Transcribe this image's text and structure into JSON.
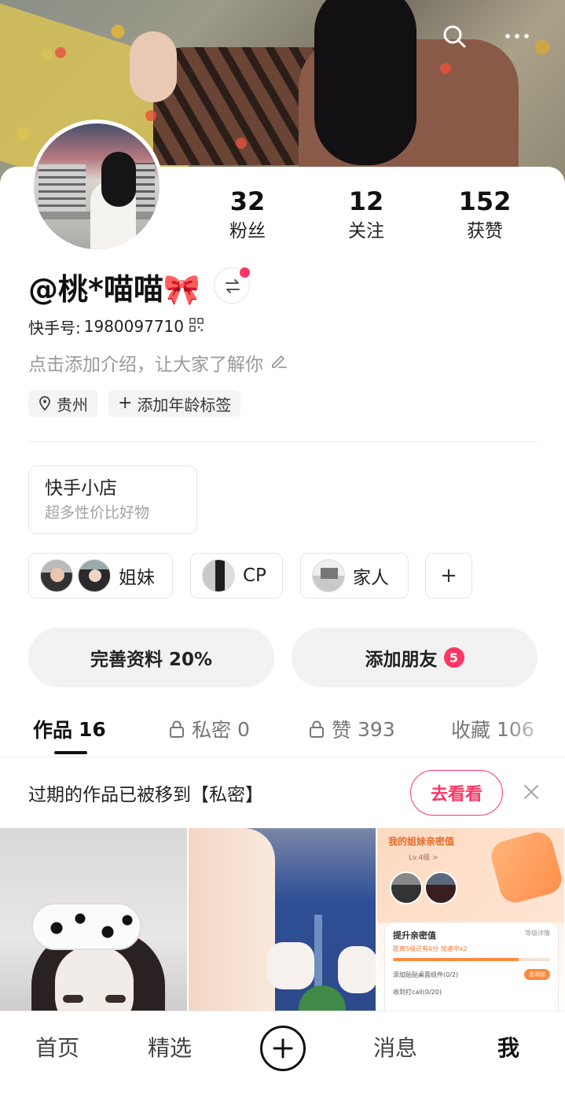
{
  "stats": [
    {
      "num": "32",
      "label": "粉丝"
    },
    {
      "num": "12",
      "label": "关注"
    },
    {
      "num": "152",
      "label": "获赞"
    }
  ],
  "profile": {
    "name": "@桃*喵喵🎀",
    "kuaishou_id_label": "快手号:",
    "kuaishou_id": "1980097710",
    "intro_placeholder": "点击添加介绍，让大家了解你",
    "location": "贵州",
    "add_age_tag": "添加年龄标签"
  },
  "shop": {
    "title": "快手小店",
    "subtitle": "超多性价比好物"
  },
  "relations": [
    {
      "label": "姐妹"
    },
    {
      "label": "CP"
    },
    {
      "label": "家人"
    }
  ],
  "buttons": {
    "complete_profile": "完善资料 20%",
    "add_friends": "添加朋友",
    "add_friends_badge": "5"
  },
  "tabs": [
    {
      "label": "作品",
      "count": "16"
    },
    {
      "label": "私密",
      "count": "0"
    },
    {
      "label": "赞",
      "count": "393"
    },
    {
      "label": "收藏",
      "count": "106"
    }
  ],
  "notice": {
    "text": "过期的作品已被移到【私密】",
    "action": "去看看"
  },
  "thumbnail3": {
    "title": "我的姐妹亲密值",
    "level": "Lv.4级 >",
    "card_title": "提升亲密值",
    "card_link": "等级详情",
    "card_sub": "距离5级还有6分 加速中x2",
    "task1": "添加贴贴桌面组件(0/2)",
    "task1_btn": "去添加",
    "task2": "收到打call(0/20)"
  },
  "bottom_nav": [
    "首页",
    "精选",
    "消息",
    "我"
  ],
  "colors": {
    "accent": "#fe3666"
  }
}
